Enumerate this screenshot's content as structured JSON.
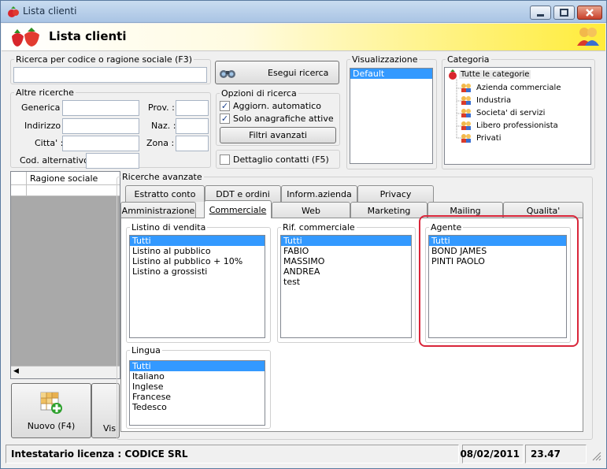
{
  "window": {
    "title": "Lista clienti"
  },
  "header": {
    "title": "Lista clienti"
  },
  "search": {
    "legend": "Ricerca per codice o ragione sociale (F3)",
    "button": "Esegui ricerca"
  },
  "altre": {
    "legend": "Altre ricerche",
    "generica": "Generica :",
    "indirizzo": "Indirizzo :",
    "citta": "Citta' :",
    "cod_alt": "Cod. alternativo :",
    "prov": "Prov. :",
    "naz": "Naz. :",
    "zona": "Zona :"
  },
  "opzioni": {
    "legend": "Opzioni di ricerca",
    "aggiorn": "Aggiorn. automatico",
    "solo": "Solo anagrafiche attive",
    "filtri": "Filtri avanzati"
  },
  "dettaglio": "Dettaglio contatti (F5)",
  "visualizzazione": {
    "legend": "Visualizzazione",
    "items": [
      "Default"
    ]
  },
  "categoria": {
    "legend": "Categoria",
    "root": "Tutte le categorie",
    "items": [
      "Azienda commerciale",
      "Industria",
      "Societa' di servizi",
      "Libero professionista",
      "Privati"
    ]
  },
  "grid": {
    "col": "Ragione sociale"
  },
  "ricerche": {
    "legend": "Ricerche avanzate"
  },
  "tabs_back": [
    "Estratto conto",
    "DDT e ordini",
    "Inform.azienda",
    "Privacy"
  ],
  "tabs_front": [
    "Amministrazione",
    "Commerciale",
    "Web",
    "Marketing",
    "Mailing",
    "Qualita'"
  ],
  "listino": {
    "legend": "Listino di vendita",
    "items": [
      "Tutti",
      "Listino al pubblico",
      "Listino al pubblico + 10%",
      "Listino a grossisti"
    ]
  },
  "rif": {
    "legend": "Rif. commerciale",
    "items": [
      "Tutti",
      "FABIO",
      "MASSIMO",
      "ANDREA",
      "test"
    ]
  },
  "agente": {
    "legend": "Agente",
    "items": [
      "Tutti",
      "BOND JAMES",
      "PINTI PAOLO"
    ]
  },
  "lingua": {
    "legend": "Lingua",
    "items": [
      "Tutti",
      "Italiano",
      "Inglese",
      "Francese",
      "Tedesco"
    ]
  },
  "actions": {
    "nuovo": "Nuovo (F4)",
    "vis": "Vis"
  },
  "status": {
    "licenza": "Intestatario licenza : CODICE SRL",
    "date": "08/02/2011",
    "time": "23.47"
  },
  "colors": {
    "selection": "#3399ff",
    "highlight": "#d9263a",
    "header_yellow": "#ffec3a"
  }
}
